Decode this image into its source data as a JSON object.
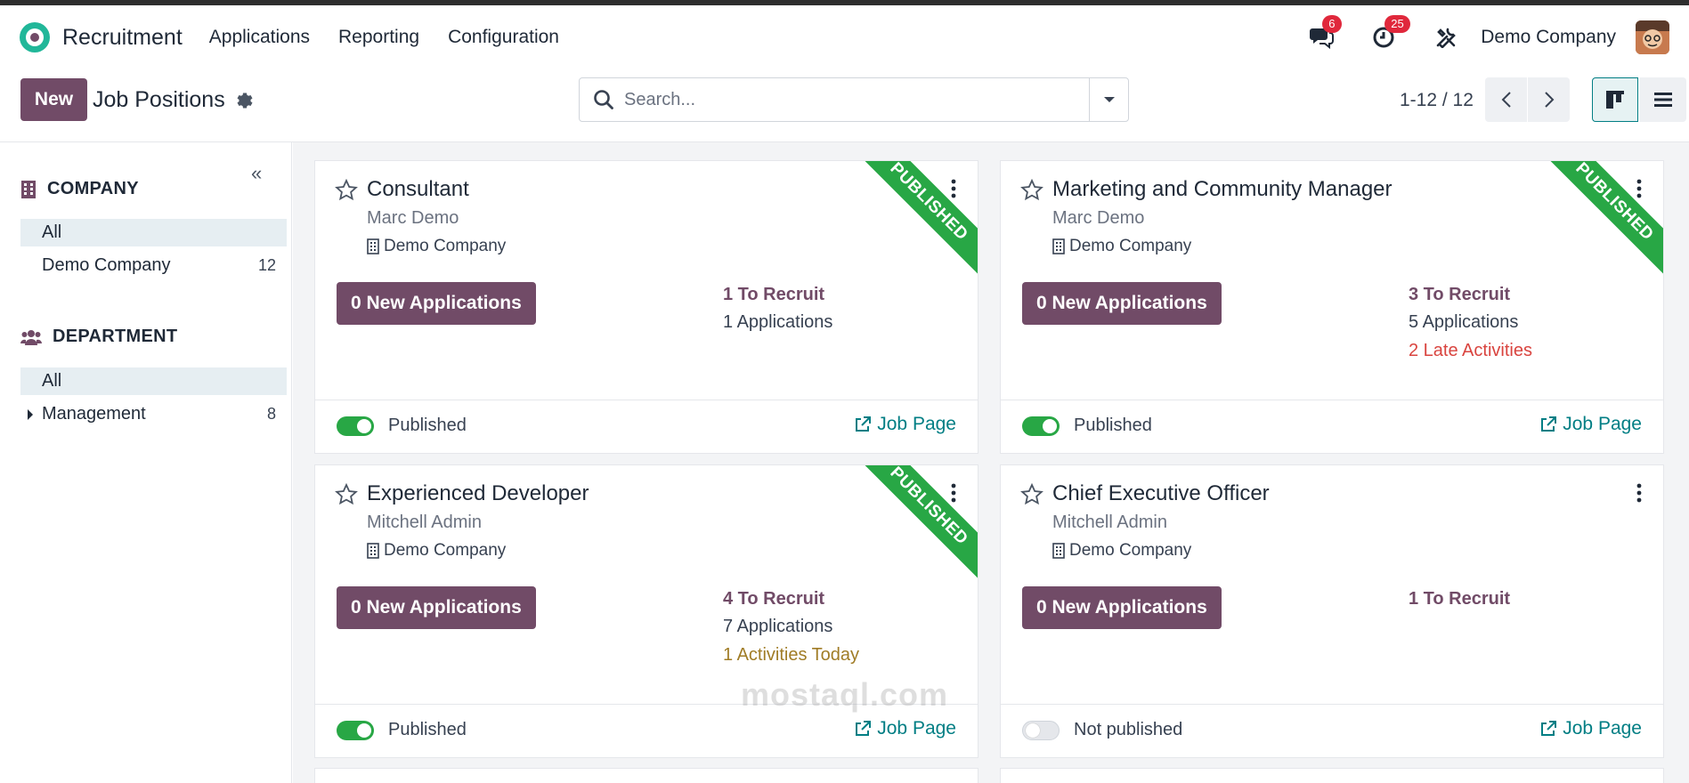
{
  "navbar": {
    "app_name": "Recruitment",
    "menus": [
      "Applications",
      "Reporting",
      "Configuration"
    ],
    "messages_count": "6",
    "activities_count": "25",
    "company": "Demo Company"
  },
  "control": {
    "new_label": "New",
    "title": "Job Positions",
    "search_placeholder": "Search...",
    "pager": "1-12 / 12"
  },
  "sidebar": {
    "company_header": "COMPANY",
    "company_items": [
      {
        "label": "All",
        "count": ""
      },
      {
        "label": "Demo Company",
        "count": "12"
      }
    ],
    "department_header": "DEPARTMENT",
    "department_items": [
      {
        "label": "All",
        "count": ""
      },
      {
        "label": "Management",
        "count": "8"
      }
    ]
  },
  "cards": [
    {
      "title": "Consultant",
      "user": "Marc Demo",
      "company": "Demo Company",
      "new_apps": "0 New Applications",
      "to_recruit": "1 To Recruit",
      "applications": "1 Applications",
      "extra": "",
      "ribbon": "PUBLISHED",
      "published_label": "Published",
      "job_page": "Job Page"
    },
    {
      "title": "Marketing and Community Manager",
      "user": "Marc Demo",
      "company": "Demo Company",
      "new_apps": "0 New Applications",
      "to_recruit": "3 To Recruit",
      "applications": "5 Applications",
      "extra": "2 Late Activities",
      "ribbon": "PUBLISHED",
      "published_label": "Published",
      "job_page": "Job Page"
    },
    {
      "title": "Experienced Developer",
      "user": "Mitchell Admin",
      "company": "Demo Company",
      "new_apps": "0 New Applications",
      "to_recruit": "4 To Recruit",
      "applications": "7 Applications",
      "extra": "1 Activities Today",
      "ribbon": "PUBLISHED",
      "published_label": "Published",
      "job_page": "Job Page"
    },
    {
      "title": "Chief Executive Officer",
      "user": "Mitchell Admin",
      "company": "Demo Company",
      "new_apps": "0 New Applications",
      "to_recruit": "1 To Recruit",
      "applications": "",
      "extra": "",
      "ribbon": "",
      "published_label": "Not published",
      "job_page": "Job Page"
    }
  ],
  "watermark": "mostaql.com",
  "colors": {
    "brand": "#714b67",
    "teal": "#017e84",
    "success": "#28a745",
    "late": "#d9443f",
    "today": "#a07c26"
  }
}
